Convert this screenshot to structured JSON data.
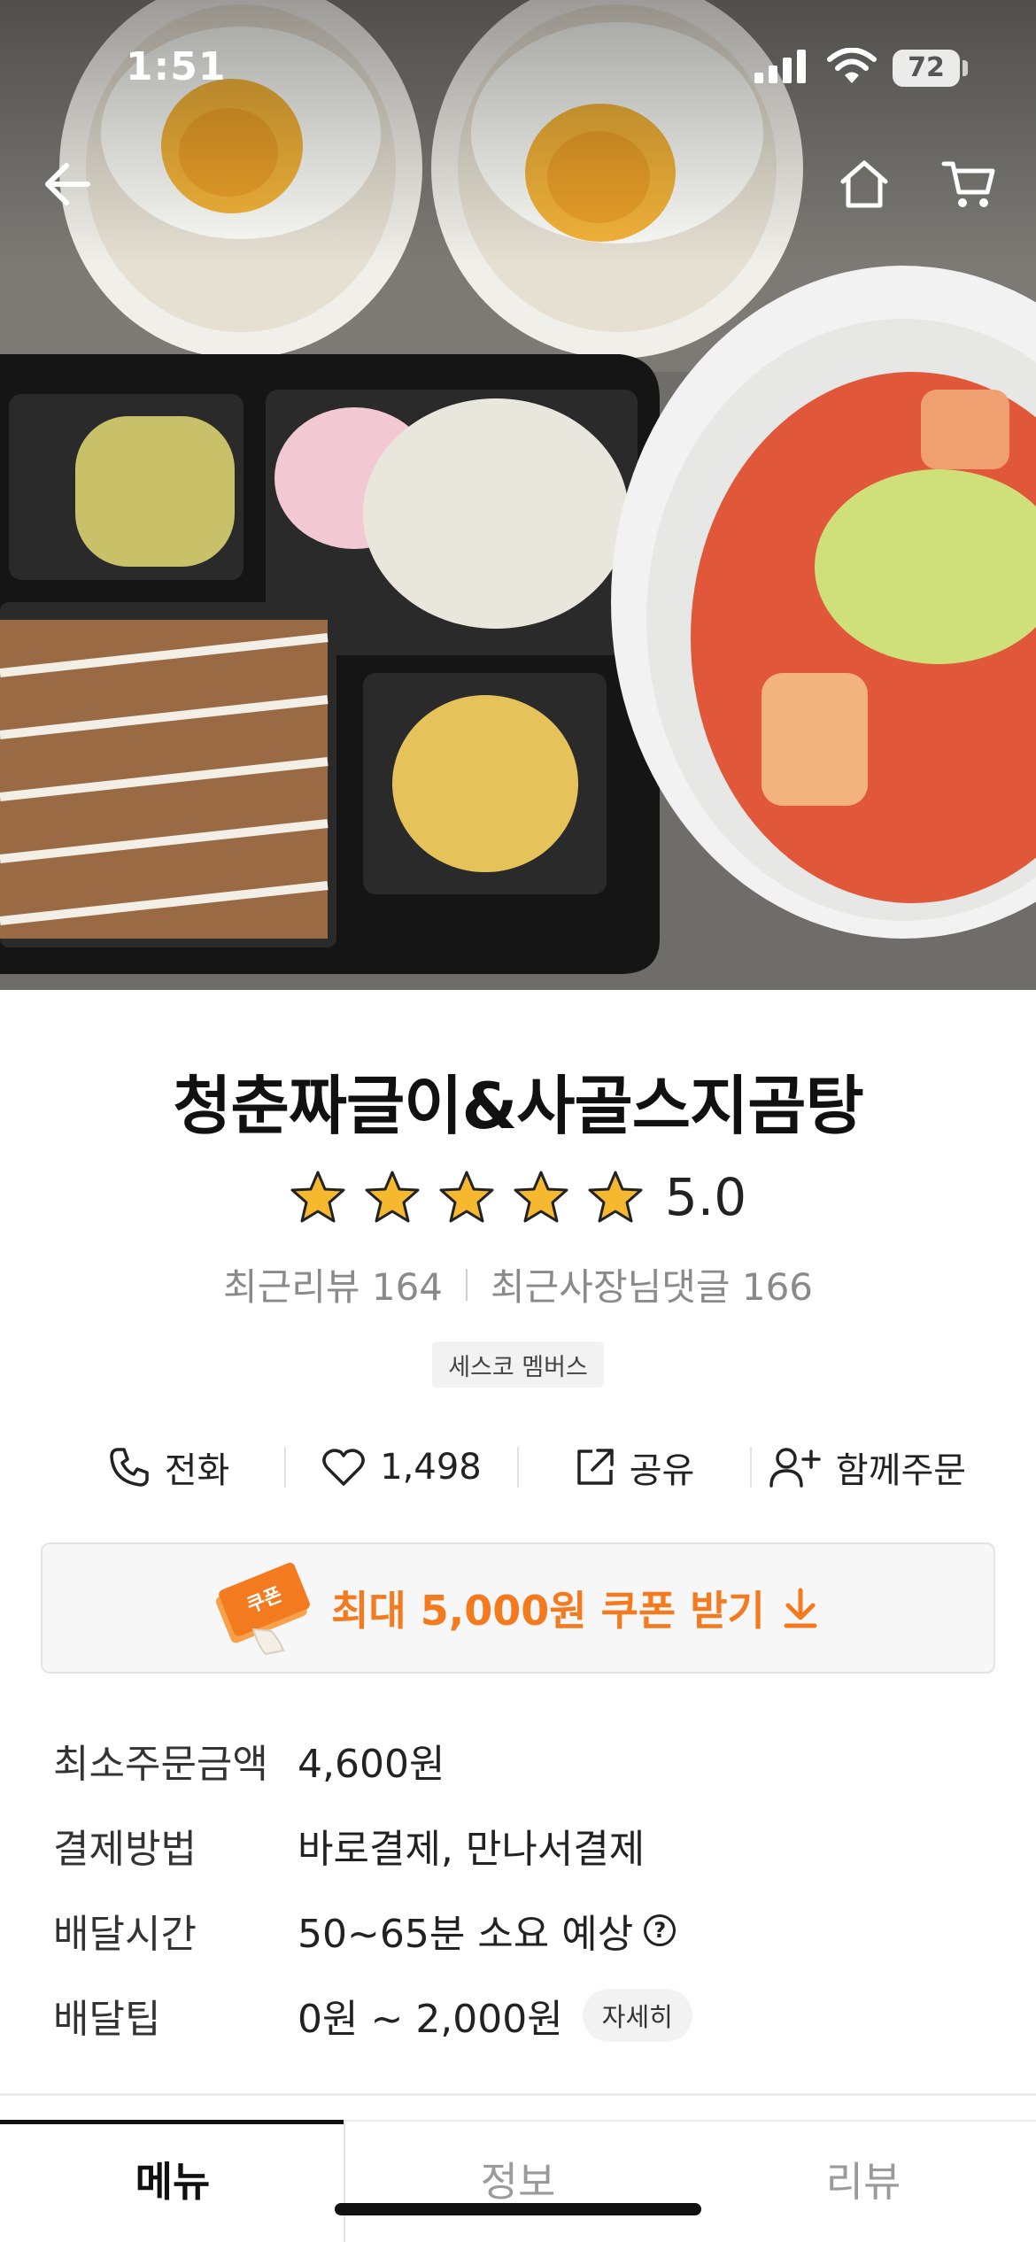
{
  "status_bar": {
    "time": "1:51",
    "battery": "72"
  },
  "nav": {
    "back_icon": "arrow-left-icon",
    "home_icon": "home-icon",
    "cart_icon": "cart-icon"
  },
  "store": {
    "name": "청춘짜글이&사골스지곰탕",
    "rating": "5.0",
    "star_count": 5,
    "recent_reviews": "최근리뷰 164",
    "recent_owner_replies": "최근사장님댓글 166",
    "badge": "세스코 멤버스"
  },
  "actions": {
    "call": "전화",
    "likes": "1,498",
    "share": "공유",
    "group_order": "함께주문"
  },
  "coupon": {
    "icon_text": "쿠폰",
    "label": "최대 5,000원 쿠폰 받기"
  },
  "info": {
    "min_order_label": "최소주문금액",
    "min_order_value": "4,600원",
    "payment_label": "결제방법",
    "payment_value": "바로결제, 만나서결제",
    "delivery_time_label": "배달시간",
    "delivery_time_value": "50~65분 소요 예상",
    "delivery_tip_label": "배달팁",
    "delivery_tip_value": "0원 ~ 2,000원",
    "delivery_tip_detail": "자세히"
  },
  "tabs": {
    "menu": "메뉴",
    "info": "정보",
    "review": "리뷰",
    "active": "메뉴"
  },
  "colors": {
    "accent": "#F47A1F",
    "star": "#F5B82E",
    "text": "#222222",
    "muted": "#8A8A8A"
  }
}
